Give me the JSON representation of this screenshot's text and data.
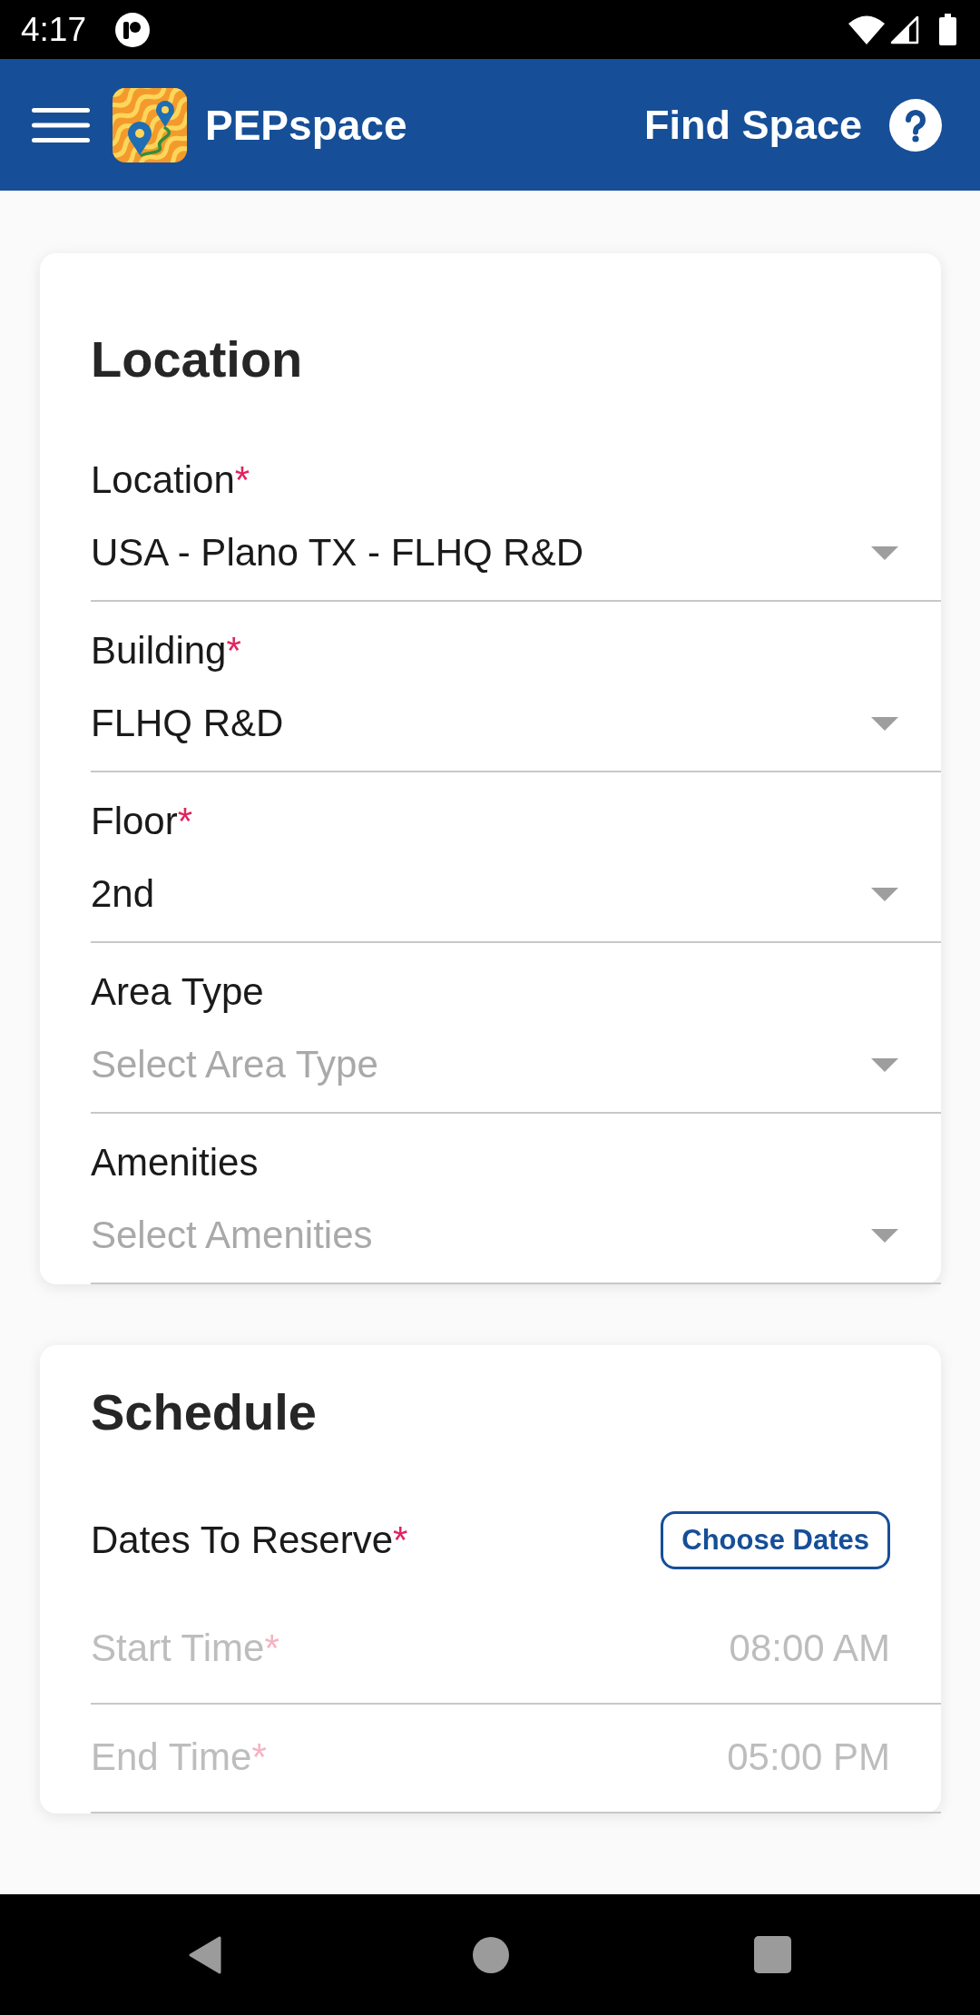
{
  "status_bar": {
    "time": "4:17"
  },
  "app_bar": {
    "app_name": "PEPspace",
    "title": "Find Space"
  },
  "location_card": {
    "heading": "Location",
    "fields": [
      {
        "label": "Location",
        "required_mark": "*",
        "value": "USA - Plano TX - FLHQ R&D"
      },
      {
        "label": "Building",
        "required_mark": "*",
        "value": "FLHQ R&D"
      },
      {
        "label": "Floor",
        "required_mark": "*",
        "value": "2nd"
      },
      {
        "label": "Area Type",
        "placeholder": "Select Area Type"
      },
      {
        "label": "Amenities",
        "placeholder": "Select Amenities"
      }
    ]
  },
  "schedule_card": {
    "heading": "Schedule",
    "dates": {
      "label": "Dates To Reserve",
      "required_mark": "*",
      "button": "Choose Dates"
    },
    "times": [
      {
        "label": "Start Time",
        "required_mark": "*",
        "value": "08:00 AM",
        "disabled": true
      },
      {
        "label": "End Time",
        "required_mark": "*",
        "value": "05:00 PM",
        "disabled": true
      }
    ]
  }
}
